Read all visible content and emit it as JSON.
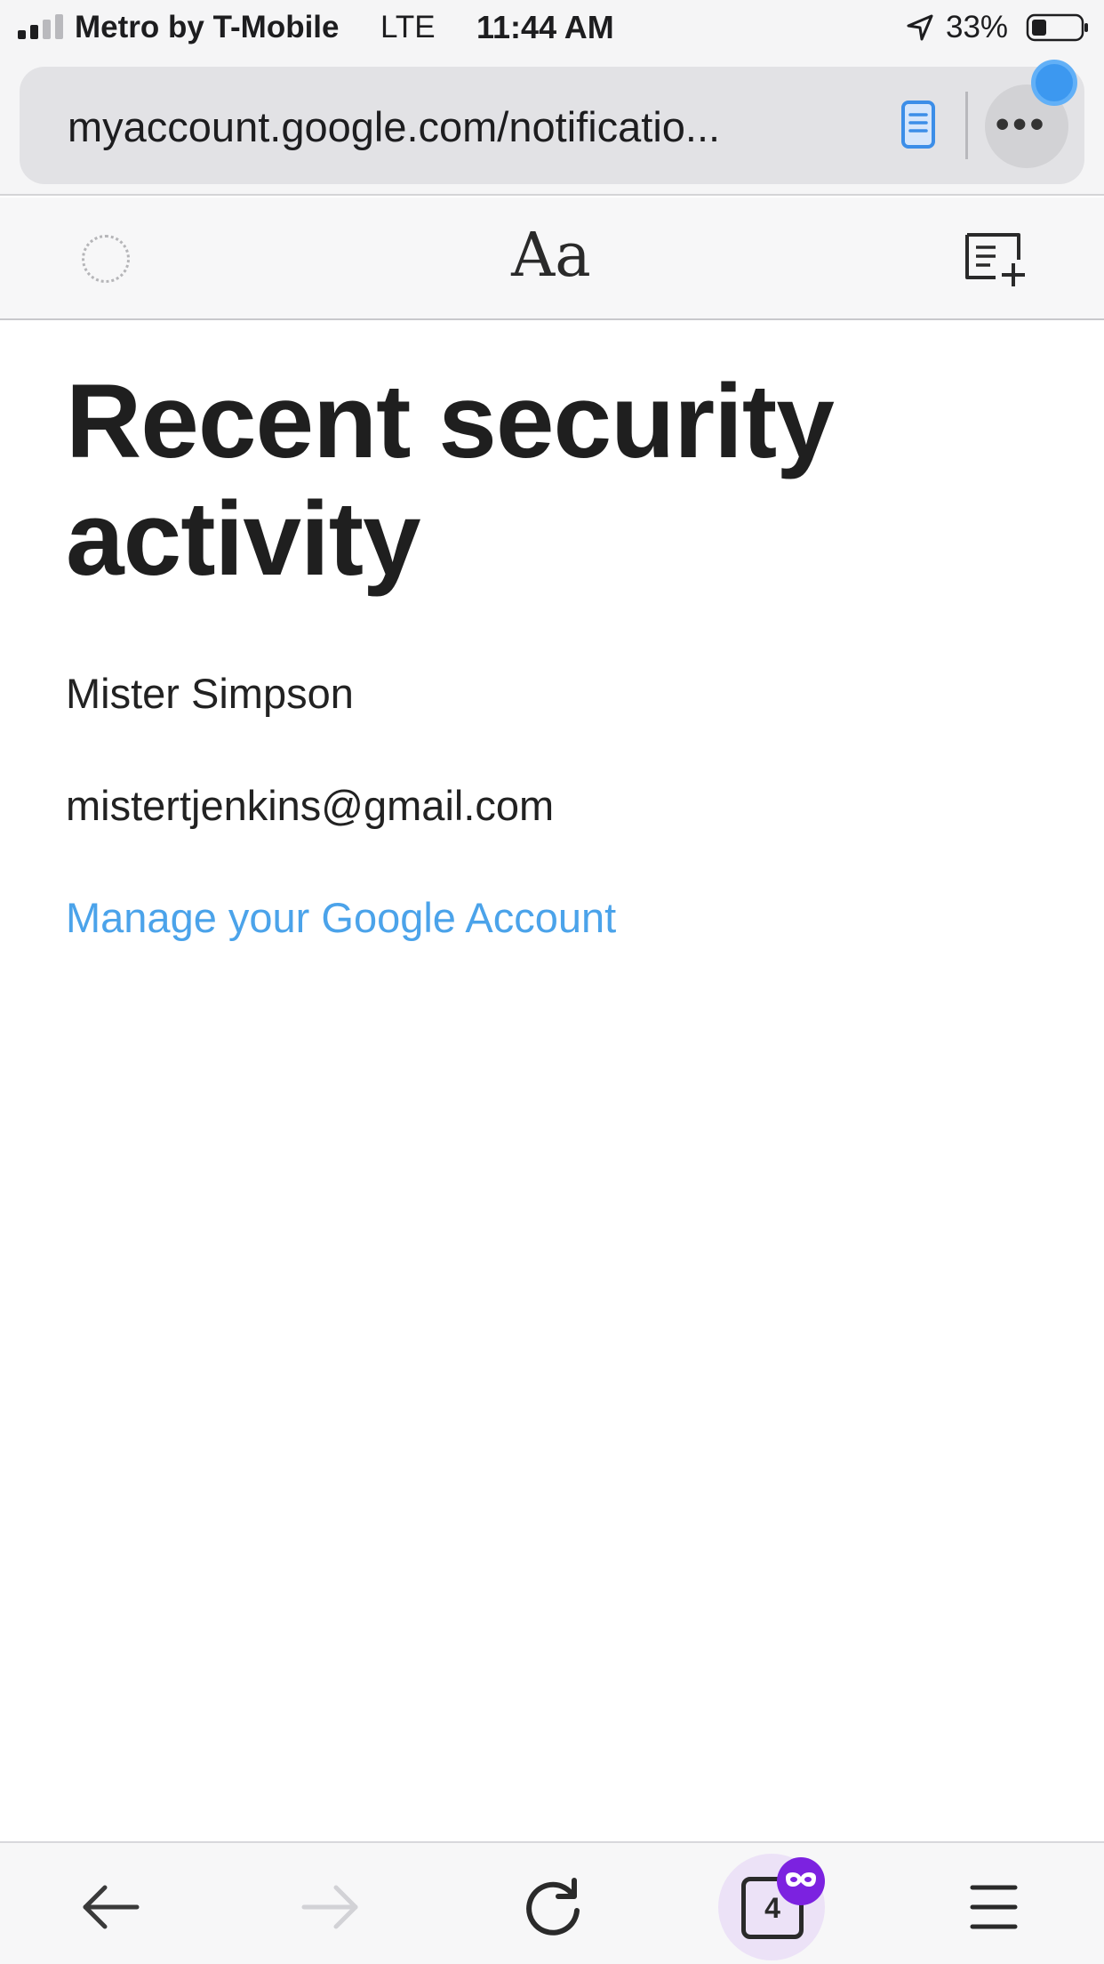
{
  "status_bar": {
    "carrier": "Metro by T-Mobile",
    "network": "LTE",
    "time": "11:44 AM",
    "battery_percent": "33%",
    "signal_bars": 2
  },
  "browser": {
    "url": "myaccount.google.com/notificatio...",
    "menu_dots": "•••",
    "font_button": "Aa",
    "tab_count": "4",
    "notification_color": "#3c98f0",
    "private_color": "#7c22e0"
  },
  "content": {
    "title": "Recent security activity",
    "name": "Mister Simpson",
    "email": "mistertjenkins@gmail.com",
    "manage_link": "Manage your Google Account",
    "link_color": "#4ba3ea"
  },
  "icons": [
    "signal-icon",
    "location-icon",
    "battery-icon",
    "reader-mode-icon",
    "loading-spinner-icon",
    "add-reading-list-icon",
    "back-arrow-icon",
    "forward-arrow-icon",
    "reload-icon",
    "tabs-icon",
    "private-mask-icon",
    "hamburger-menu-icon"
  ]
}
